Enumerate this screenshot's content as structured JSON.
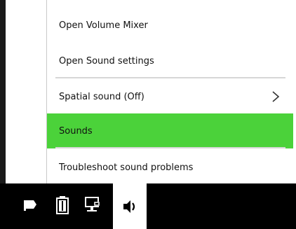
{
  "theme": {
    "accent": "#4bd23a"
  },
  "context_menu": {
    "items": [
      {
        "label": "Open Volume Mixer"
      },
      {
        "label": "Open Sound settings"
      },
      {
        "label": "Spatial sound (Off)",
        "submenu_icon": "chevron-right-icon"
      },
      {
        "label": "Sounds",
        "highlighted": true
      },
      {
        "label": "Troubleshoot sound problems"
      }
    ]
  },
  "taskbar": {
    "tray_icons": [
      {
        "icon": "flag-icon"
      },
      {
        "icon": "battery-icon"
      },
      {
        "icon": "network-icon"
      },
      {
        "icon": "volume-icon",
        "active": true
      }
    ]
  }
}
